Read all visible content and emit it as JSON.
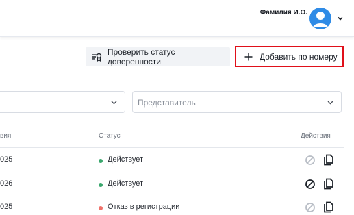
{
  "header": {
    "user_name": "Фамилия И.О.",
    "avatar_color": "#2f8be6"
  },
  "toolbar": {
    "check_status_label": "Проверить статус доверенности",
    "add_by_number_label": "Добавить по номеру"
  },
  "filters": {
    "representative_placeholder": "Представитель"
  },
  "table": {
    "columns": {
      "date": "вия",
      "status": "Статус",
      "actions": "Действия"
    },
    "rows": [
      {
        "date": "025",
        "status": "Действует",
        "status_color": "#3aa76d",
        "revoke_enabled": false
      },
      {
        "date": "026",
        "status": "Действует",
        "status_color": "#3aa76d",
        "revoke_enabled": true
      },
      {
        "date": "025",
        "status": "Отказ в регистрации",
        "status_color": "#f0726b",
        "revoke_enabled": false
      }
    ]
  },
  "icons": {
    "check": "certificate-icon",
    "add": "plus-icon",
    "avatar": "user-icon",
    "revoke": "block-icon",
    "copy": "copy-icon"
  }
}
